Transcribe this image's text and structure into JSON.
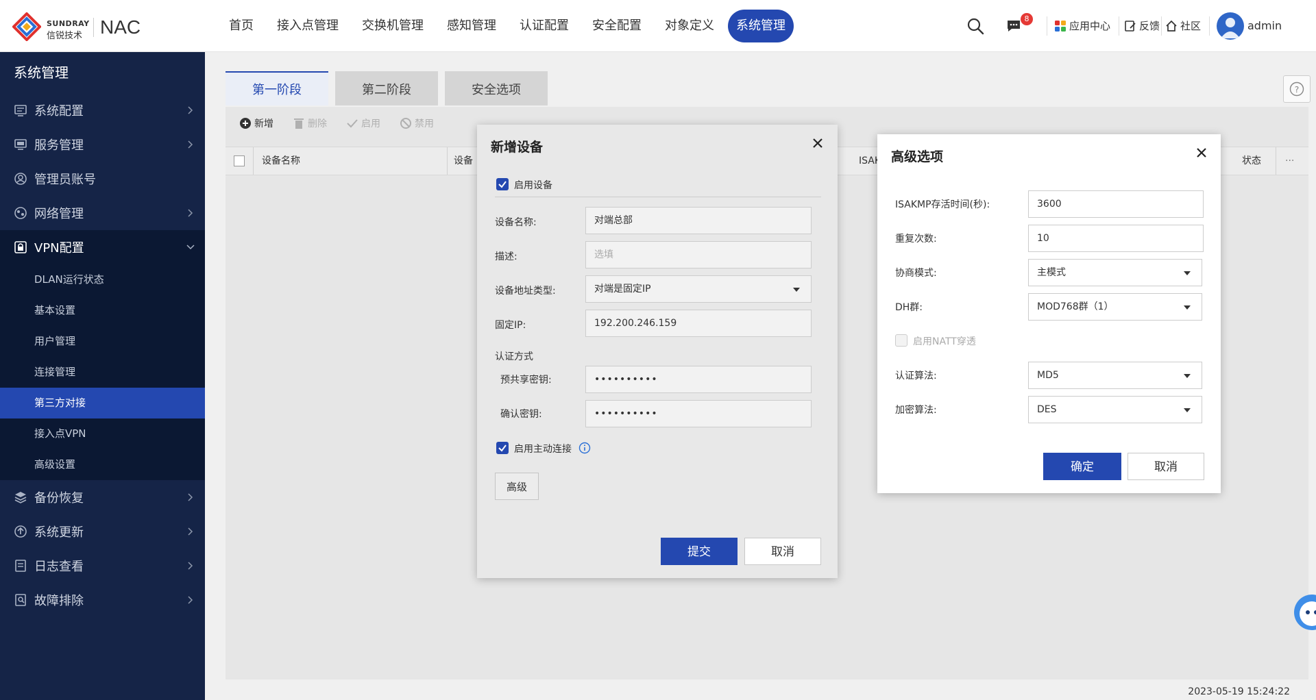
{
  "brand": {
    "en": "SUNDRAY",
    "cn": "信锐技术",
    "product": "NAC"
  },
  "topnav": {
    "items": [
      {
        "label": "首页"
      },
      {
        "label": "接入点管理"
      },
      {
        "label": "交换机管理"
      },
      {
        "label": "感知管理"
      },
      {
        "label": "认证配置"
      },
      {
        "label": "安全配置"
      },
      {
        "label": "对象定义"
      },
      {
        "label": "系统管理",
        "active": true
      }
    ]
  },
  "header": {
    "message_badge": "8",
    "app_center": "应用中心",
    "feedback": "反馈",
    "community": "社区",
    "username": "admin"
  },
  "sidebar": {
    "title": "系统管理",
    "items": [
      {
        "label": "系统配置",
        "icon": "settings-icon"
      },
      {
        "label": "服务管理",
        "icon": "monitor-icon"
      },
      {
        "label": "管理员账号",
        "icon": "user-circle-icon"
      },
      {
        "label": "网络管理",
        "icon": "network-icon"
      },
      {
        "label": "VPN配置",
        "icon": "lock-icon",
        "expanded": true
      },
      {
        "label": "备份恢复",
        "icon": "layers-icon"
      },
      {
        "label": "系统更新",
        "icon": "upload-circle-icon"
      },
      {
        "label": "日志查看",
        "icon": "log-icon"
      },
      {
        "label": "故障排除",
        "icon": "wrench-icon"
      }
    ],
    "vpn_sub": [
      {
        "label": "DLAN运行状态"
      },
      {
        "label": "基本设置"
      },
      {
        "label": "用户管理"
      },
      {
        "label": "连接管理"
      },
      {
        "label": "第三方对接",
        "active": true
      },
      {
        "label": "接入点VPN"
      },
      {
        "label": "高级设置"
      }
    ]
  },
  "main": {
    "tabs": [
      {
        "label": "第一阶段",
        "active": true
      },
      {
        "label": "第二阶段"
      },
      {
        "label": "安全选项"
      }
    ],
    "toolbar": {
      "add": "新增",
      "delete": "删除",
      "enable": "启用",
      "disable": "禁用"
    },
    "table_headers": {
      "device_name": "设备名称",
      "device_col2": "设备",
      "isakmp": "ISAKMP",
      "status": "状态",
      "more": "···"
    },
    "timestamp": "2023-05-19 15:24:22"
  },
  "dialog_new_device": {
    "title": "新增设备",
    "enable_device": "启用设备",
    "device_name_label": "设备名称:",
    "device_name_value": "对端总部",
    "description_label": "描述:",
    "description_placeholder": "选填",
    "address_type_label": "设备地址类型:",
    "address_type_value": "对端是固定IP",
    "fixed_ip_label": "固定IP:",
    "fixed_ip_value": "192.200.246.159",
    "auth_method_label": "认证方式",
    "psk_label": "预共享密钥:",
    "psk_value": "••••••••••",
    "confirm_key_label": "确认密钥:",
    "confirm_key_value": "••••••••••",
    "enable_active_connect": "启用主动连接",
    "advanced_button": "高级",
    "submit_button": "提交",
    "cancel_button": "取消"
  },
  "dialog_advanced": {
    "title": "高级选项",
    "isakmp_keepalive_label": "ISAKMP存活时间(秒):",
    "isakmp_keepalive_value": "3600",
    "retry_label": "重复次数:",
    "retry_value": "10",
    "negotiation_mode_label": "协商模式:",
    "negotiation_mode_value": "主模式",
    "dh_group_label": "DH群:",
    "dh_group_value": "MOD768群（1）",
    "nat_traversal": "启用NATT穿透",
    "auth_algo_label": "认证算法:",
    "auth_algo_value": "MD5",
    "enc_algo_label": "加密算法:",
    "enc_algo_value": "DES",
    "ok_button": "确定",
    "cancel_button": "取消"
  },
  "colors": {
    "primary": "#2448b0",
    "sidebar_bg": "#152447",
    "sidebar_sub_bg": "#0b1833",
    "badge": "#e53935"
  }
}
